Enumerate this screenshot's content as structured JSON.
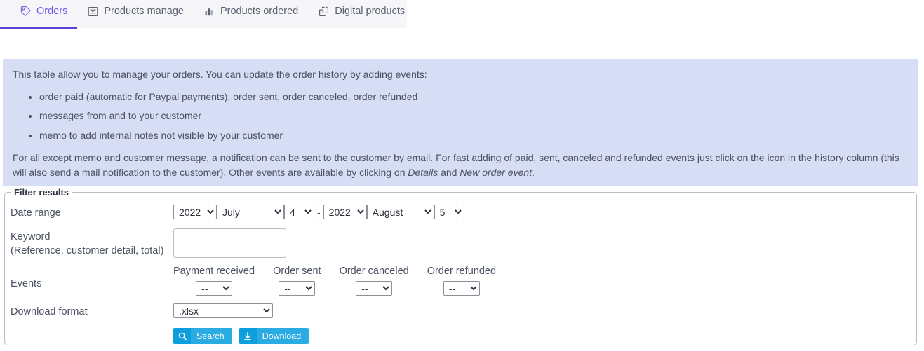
{
  "tabs": [
    {
      "label": "Orders",
      "icon": "price-tag-icon",
      "active": true
    },
    {
      "label": "Products manage",
      "icon": "products-manage-icon",
      "active": false
    },
    {
      "label": "Products ordered",
      "icon": "bar-chart-icon",
      "active": false
    },
    {
      "label": "Digital products",
      "icon": "digital-products-icon",
      "active": false
    }
  ],
  "info": {
    "lead": "This table allow you to manage your orders. You can update the order history by adding events:",
    "bullets": [
      "order paid (automatic for Paypal payments), order sent, order canceled, order refunded",
      "messages from and to your customer",
      "memo to add internal notes not visible by your customer"
    ],
    "tail_part1": "For all except memo and customer message, a notification can be sent to the customer by email. For fast adding of paid, sent, canceled and refunded events just click on the icon in the history column (this will also send a mail notification to the customer). Other events are available by clicking on ",
    "tail_em1": "Details",
    "tail_part2": " and ",
    "tail_em2": "New order event",
    "tail_part3": ".",
    "background_color": "#d6ddf5"
  },
  "filter": {
    "legend": "Filter results",
    "date_range": {
      "label": "Date range",
      "separator": "-",
      "from": {
        "year": "2022",
        "month": "July",
        "day": "4"
      },
      "to": {
        "year": "2022",
        "month": "August",
        "day": "5"
      }
    },
    "keyword": {
      "label_line1": "Keyword",
      "label_line2": "(Reference, customer detail, total)",
      "value": "",
      "placeholder": ""
    },
    "events": {
      "label": "Events",
      "columns": [
        {
          "label": "Payment received",
          "value": "--"
        },
        {
          "label": "Order sent",
          "value": "--"
        },
        {
          "label": "Order canceled",
          "value": "--"
        },
        {
          "label": "Order refunded",
          "value": "--"
        }
      ]
    },
    "download_format": {
      "label": "Download format",
      "value": ".xlsx"
    },
    "buttons": [
      {
        "label": "Search",
        "icon": "magnifier-icon",
        "color": "#2aabe2"
      },
      {
        "label": "Download",
        "icon": "download-arrow-icon",
        "color": "#2aabe2"
      }
    ]
  }
}
